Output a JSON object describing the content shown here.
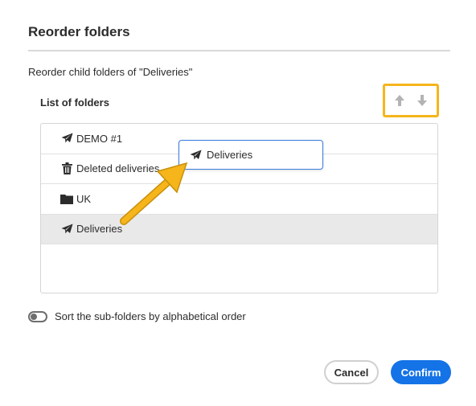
{
  "dialog": {
    "title": "Reorder folders",
    "description": "Reorder child folders of \"Deliveries\"",
    "list_label": "List of folders"
  },
  "folders": [
    {
      "label": "DEMO #1",
      "icon": "paper-plane-icon",
      "selected": false
    },
    {
      "label": "Deleted deliveries",
      "icon": "trash-icon",
      "selected": false
    },
    {
      "label": "UK",
      "icon": "folder-icon",
      "selected": false
    },
    {
      "label": "Deliveries",
      "icon": "paper-plane-icon",
      "selected": true
    }
  ],
  "drag_ghost": {
    "label": "Deliveries",
    "icon": "paper-plane-icon"
  },
  "toggle": {
    "label": "Sort the sub-folders by alphabetical order",
    "on": false
  },
  "buttons": {
    "cancel": "Cancel",
    "confirm": "Confirm"
  },
  "colors": {
    "accent": "#1473e6",
    "highlight": "#f5b51b",
    "selected_row": "#e9e9e9",
    "ghost_border": "#3b7de0"
  }
}
